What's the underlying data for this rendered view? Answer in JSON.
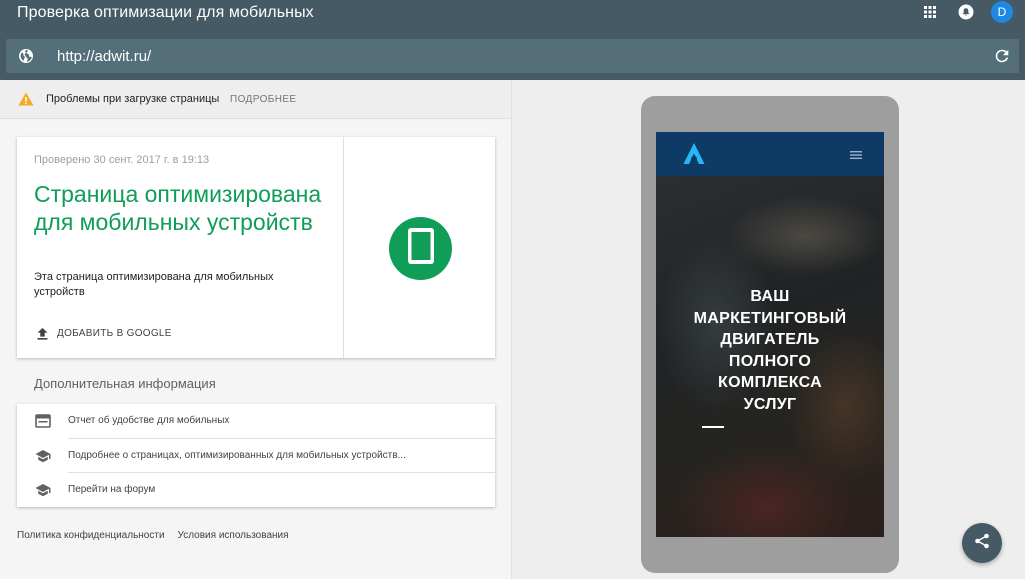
{
  "header": {
    "title": "Проверка оптимизации для мобильных",
    "avatar_letter": "D"
  },
  "url_bar": {
    "url": "http://adwit.ru/"
  },
  "warning": {
    "text": "Проблемы при загрузке страницы",
    "link": "ПОДРОБНЕЕ"
  },
  "result": {
    "checked": "Проверено 30 сент. 2017 г. в 19:13",
    "title": "Страница оптимизирована для мобильных устройств",
    "description": "Эта страница оптимизирована для мобильных устройств",
    "add_button": "ДОБАВИТЬ В GOOGLE",
    "badge_color": "#0f9d58"
  },
  "more_info": {
    "title": "Дополнительная информация",
    "items": [
      {
        "icon": "report-icon",
        "label": "Отчет об удобстве для мобильных"
      },
      {
        "icon": "school-icon",
        "label": "Подробнее о страницах, оптимизированных для мобильных устройств..."
      },
      {
        "icon": "school-icon",
        "label": "Перейти на форум"
      }
    ]
  },
  "footer": {
    "privacy": "Политика конфиденциальности",
    "terms": "Условия использования"
  },
  "preview": {
    "hero_lines": [
      "ВАШ",
      "МАРКЕТИНГОВЫЙ",
      "ДВИГАТЕЛЬ",
      "ПОЛНОГО",
      "КОМПЛЕКСА",
      "УСЛУГ"
    ]
  },
  "colors": {
    "header": "#455a64",
    "accent_green": "#0f9d58",
    "avatar": "#1e88e5"
  }
}
